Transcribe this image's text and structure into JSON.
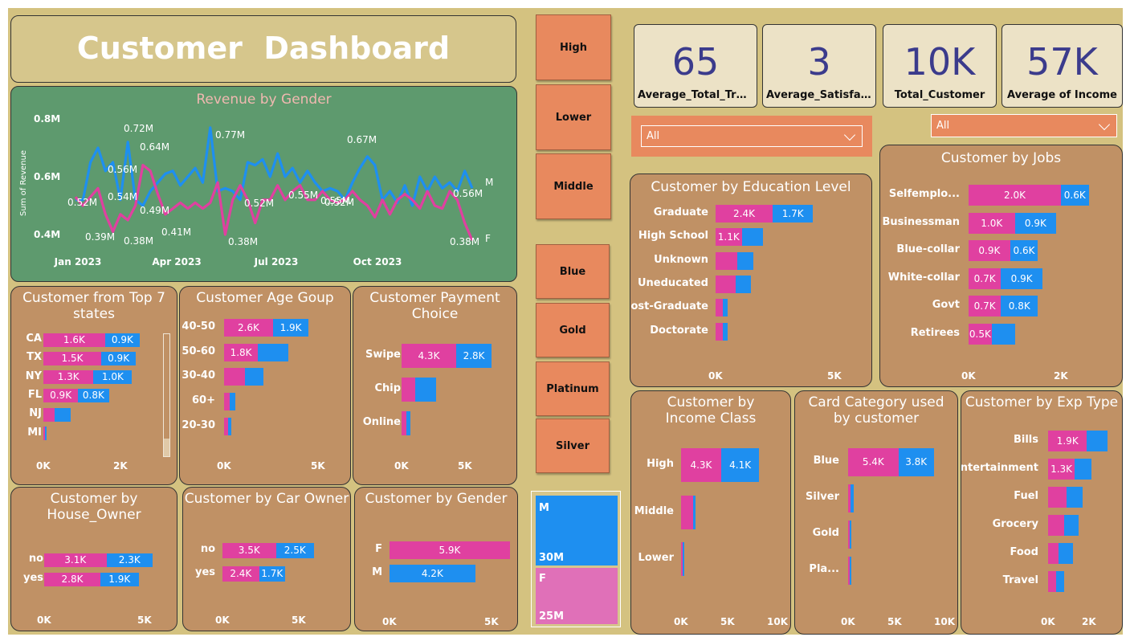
{
  "title": "Customer  Dashboard",
  "colors": {
    "female": "#e040a0",
    "male": "#1e8ff0",
    "panel": "#c09165",
    "background": "#d4c280",
    "slicer": "#e8895e",
    "revenue_panel": "#5e9a6e"
  },
  "income_slicer": {
    "items": [
      "High",
      "Lower",
      "Middle"
    ]
  },
  "card_slicer": {
    "items": [
      "Blue",
      "Gold",
      "Platinum",
      "Silver"
    ]
  },
  "kpis": [
    {
      "value": "65",
      "label": "Average_Total_Trans..."
    },
    {
      "value": "3",
      "label": "Average_Satisfacti..."
    },
    {
      "value": "10K",
      "label": "Total_Customer"
    },
    {
      "value": "57K",
      "label": "Average of Income"
    }
  ],
  "filters": {
    "left_value": "All",
    "right_value": "All"
  },
  "treemap": {
    "items": [
      {
        "name": "M",
        "value": "30M"
      },
      {
        "name": "F",
        "value": "25M"
      }
    ]
  },
  "charts": {
    "revenue": {
      "title": "Revenue by Gender",
      "ylabel": "Sum of Revenue",
      "yticks": [
        "0.8M",
        "0.6M",
        "0.4M"
      ],
      "xticks": [
        "Jan 2023",
        "Apr 2023",
        "Jul 2023",
        "Oct 2023"
      ],
      "annotations": [
        "0.72M",
        "0.64M",
        "0.77M",
        "0.67M",
        "0.56M",
        "0.52M",
        "0.54M",
        "0.49M",
        "0.55M",
        "0.55M",
        "0.52M",
        "0.52M",
        "0.56M",
        "0.39M",
        "0.38M",
        "0.41M",
        "0.38M",
        "0.38M"
      ],
      "series_end_labels": [
        "M",
        "F"
      ]
    },
    "states": {
      "title": "Customer from Top 7 states",
      "axis": [
        "0K",
        "2K"
      ]
    },
    "age": {
      "title": "Customer Age Goup",
      "axis": [
        "0K",
        "5K"
      ]
    },
    "payment": {
      "title": "Customer Payment Choice",
      "axis": [
        "0K",
        "5K"
      ]
    },
    "house": {
      "title": "Customer by House_Owner",
      "axis": [
        "0K",
        "5K"
      ]
    },
    "car": {
      "title": "Customer by Car Owner",
      "axis": [
        "0K",
        "5K"
      ]
    },
    "gender": {
      "title": "Customer by Gender",
      "axis": [
        "0K",
        "5K"
      ]
    },
    "education": {
      "title": "Customer by Education Level",
      "axis": [
        "0K",
        "5K"
      ]
    },
    "jobs": {
      "title": "Customer by Jobs",
      "axis": [
        "0K",
        "2K"
      ]
    },
    "income": {
      "title": "Customer by Income Class",
      "axis": [
        "0K",
        "5K",
        "10K"
      ]
    },
    "card": {
      "title": "Card Category used by customer",
      "axis": [
        "0K",
        "5K",
        "10K"
      ]
    },
    "exp": {
      "title": "Customer by Exp Type",
      "axis": [
        "0K",
        "2K"
      ]
    }
  },
  "chart_data": [
    {
      "type": "line",
      "title": "Revenue by Gender",
      "ylabel": "Sum of Revenue",
      "ylim": [
        0.35,
        0.8
      ],
      "series": [
        {
          "name": "M",
          "values": [
            0.52,
            0.52,
            0.65,
            0.7,
            0.62,
            0.65,
            0.52,
            0.72,
            0.52,
            0.5,
            0.55,
            0.58,
            0.61,
            0.62,
            0.57,
            0.6,
            0.63,
            0.58,
            0.77,
            0.55,
            0.56,
            0.55,
            0.52,
            0.65,
            0.64,
            0.66,
            0.6,
            0.68,
            0.6,
            0.63,
            0.58,
            0.62,
            0.58,
            0.55,
            0.56,
            0.55,
            0.52,
            0.58,
            0.63,
            0.67,
            0.64,
            0.52,
            0.55,
            0.51,
            0.57,
            0.5,
            0.6,
            0.55,
            0.6,
            0.56,
            0.58,
            0.55,
            0.62,
            0.56
          ]
        },
        {
          "name": "F",
          "values": [
            0.53,
            0.5,
            0.53,
            0.56,
            0.47,
            0.41,
            0.47,
            0.45,
            0.5,
            0.64,
            0.62,
            0.54,
            0.47,
            0.49,
            0.51,
            0.49,
            0.51,
            0.49,
            0.51,
            0.58,
            0.4,
            0.52,
            0.57,
            0.52,
            0.44,
            0.52,
            0.52,
            0.57,
            0.52,
            0.55,
            0.57,
            0.52,
            0.52,
            0.55,
            0.52,
            0.51,
            0.52,
            0.55,
            0.52,
            0.5,
            0.46,
            0.52,
            0.47,
            0.52,
            0.54,
            0.52,
            0.49,
            0.55,
            0.5,
            0.49,
            0.55,
            0.52,
            0.44,
            0.38
          ]
        }
      ]
    },
    {
      "type": "bar",
      "title": "Customer from Top 7 states",
      "categories": [
        "CA",
        "TX",
        "NY",
        "FL",
        "NJ",
        "MI"
      ],
      "xlim": [
        0,
        3000
      ],
      "series": [
        {
          "name": "F",
          "values": [
            1600,
            1500,
            1300,
            900,
            300,
            30
          ],
          "labels": [
            "1.6K",
            "1.5K",
            "1.3K",
            "0.9K",
            "",
            ""
          ]
        },
        {
          "name": "M",
          "values": [
            900,
            900,
            1000,
            800,
            400,
            40
          ],
          "labels": [
            "0.9K",
            "0.9K",
            "1.0K",
            "0.8K",
            "",
            ""
          ]
        }
      ]
    },
    {
      "type": "bar",
      "title": "Customer Age Goup",
      "categories": [
        "40-50",
        "50-60",
        "30-40",
        "60+",
        "20-30"
      ],
      "xlim": [
        0,
        6000
      ],
      "series": [
        {
          "name": "F",
          "values": [
            2600,
            1800,
            1100,
            300,
            200
          ],
          "labels": [
            "2.6K",
            "1.8K",
            "",
            "",
            ""
          ]
        },
        {
          "name": "M",
          "values": [
            1900,
            1600,
            1000,
            300,
            200
          ],
          "labels": [
            "1.9K",
            "",
            "",
            "",
            ""
          ]
        }
      ]
    },
    {
      "type": "bar",
      "title": "Customer Payment Choice",
      "categories": [
        "Swipe",
        "Chip",
        "Online"
      ],
      "xlim": [
        0,
        6000
      ],
      "series": [
        {
          "name": "F",
          "values": [
            4300,
            1100,
            400
          ],
          "labels": [
            "4.3K",
            "",
            ""
          ]
        },
        {
          "name": "M",
          "values": [
            2800,
            1600,
            300
          ],
          "labels": [
            "2.8K",
            "",
            ""
          ]
        }
      ]
    },
    {
      "type": "bar",
      "title": "Customer by House_Owner",
      "categories": [
        "no",
        "yes"
      ],
      "xlim": [
        0,
        6000
      ],
      "series": [
        {
          "name": "F",
          "values": [
            3100,
            2800
          ],
          "labels": [
            "3.1K",
            "2.8K"
          ]
        },
        {
          "name": "M",
          "values": [
            2300,
            1900
          ],
          "labels": [
            "2.3K",
            "1.9K"
          ]
        }
      ]
    },
    {
      "type": "bar",
      "title": "Customer by Car Owner",
      "categories": [
        "no",
        "yes"
      ],
      "xlim": [
        0,
        6000
      ],
      "series": [
        {
          "name": "F",
          "values": [
            3500,
            2400
          ],
          "labels": [
            "3.5K",
            "2.4K"
          ]
        },
        {
          "name": "M",
          "values": [
            2500,
            1700
          ],
          "labels": [
            "2.5K",
            "1.7K"
          ]
        }
      ]
    },
    {
      "type": "bar",
      "title": "Customer by Gender",
      "categories": [
        "F",
        "M"
      ],
      "xlim": [
        0,
        6000
      ],
      "series": [
        {
          "name": "F",
          "values": [
            5900,
            0
          ],
          "labels": [
            "5.9K",
            ""
          ]
        },
        {
          "name": "M",
          "values": [
            0,
            4200
          ],
          "labels": [
            "",
            "4.2K"
          ]
        }
      ]
    },
    {
      "type": "bar",
      "title": "Customer by Education Level",
      "categories": [
        "Graduate",
        "High School",
        "Unknown",
        "Uneducated",
        "Post-Graduate",
        "Doctorate"
      ],
      "xlim": [
        0,
        6000
      ],
      "series": [
        {
          "name": "F",
          "values": [
            2400,
            1100,
            900,
            850,
            300,
            300
          ],
          "labels": [
            "2.4K",
            "1.1K",
            "",
            "",
            "",
            ""
          ]
        },
        {
          "name": "M",
          "values": [
            1700,
            900,
            700,
            650,
            200,
            200
          ],
          "labels": [
            "1.7K",
            "",
            "",
            "",
            "",
            ""
          ]
        }
      ]
    },
    {
      "type": "bar",
      "title": "Customer by Jobs",
      "categories": [
        "Selfemplo...",
        "Businessman",
        "Blue-collar",
        "White-collar",
        "Govt",
        "Retirees"
      ],
      "xlim": [
        0,
        3000
      ],
      "series": [
        {
          "name": "F",
          "values": [
            2000,
            1000,
            900,
            700,
            700,
            500
          ],
          "labels": [
            "2.0K",
            "1.0K",
            "0.9K",
            "0.7K",
            "0.7K",
            "0.5K"
          ]
        },
        {
          "name": "M",
          "values": [
            600,
            900,
            600,
            900,
            800,
            500
          ],
          "labels": [
            "0.6K",
            "0.9K",
            "0.6K",
            "0.9K",
            "0.8K",
            ""
          ]
        }
      ]
    },
    {
      "type": "bar",
      "title": "Customer by Income Class",
      "categories": [
        "High",
        "Middle",
        "Lower"
      ],
      "xlim": [
        0,
        11000
      ],
      "series": [
        {
          "name": "F",
          "values": [
            4300,
            1300,
            150
          ],
          "labels": [
            "4.3K",
            "",
            ""
          ]
        },
        {
          "name": "M",
          "values": [
            4100,
            250,
            50
          ],
          "labels": [
            "4.1K",
            "",
            ""
          ]
        }
      ]
    },
    {
      "type": "bar",
      "title": "Card Category used by customer",
      "categories": [
        "Blue",
        "Silver",
        "Gold",
        "Pla..."
      ],
      "xlim": [
        0,
        11000
      ],
      "series": [
        {
          "name": "F",
          "values": [
            5400,
            300,
            50,
            30
          ],
          "labels": [
            "5.4K",
            "",
            "",
            ""
          ]
        },
        {
          "name": "M",
          "values": [
            3800,
            300,
            100,
            50
          ],
          "labels": [
            "3.8K",
            "",
            "",
            ""
          ]
        }
      ]
    },
    {
      "type": "bar",
      "title": "Customer by Exp Type",
      "categories": [
        "Bills",
        "Entertainment",
        "Fuel",
        "Grocery",
        "Food",
        "Travel"
      ],
      "xlim": [
        0,
        3000
      ],
      "series": [
        {
          "name": "F",
          "values": [
            1900,
            1300,
            900,
            800,
            500,
            400
          ],
          "labels": [
            "1.9K",
            "1.3K",
            "",
            "",
            "",
            ""
          ]
        },
        {
          "name": "M",
          "values": [
            1000,
            800,
            800,
            700,
            700,
            400
          ],
          "labels": [
            "",
            "",
            "",
            "",
            "",
            ""
          ]
        }
      ]
    },
    {
      "type": "treemap",
      "categories": [
        "M",
        "F"
      ],
      "values": [
        30,
        25
      ],
      "labels": [
        "30M",
        "25M"
      ]
    }
  ]
}
